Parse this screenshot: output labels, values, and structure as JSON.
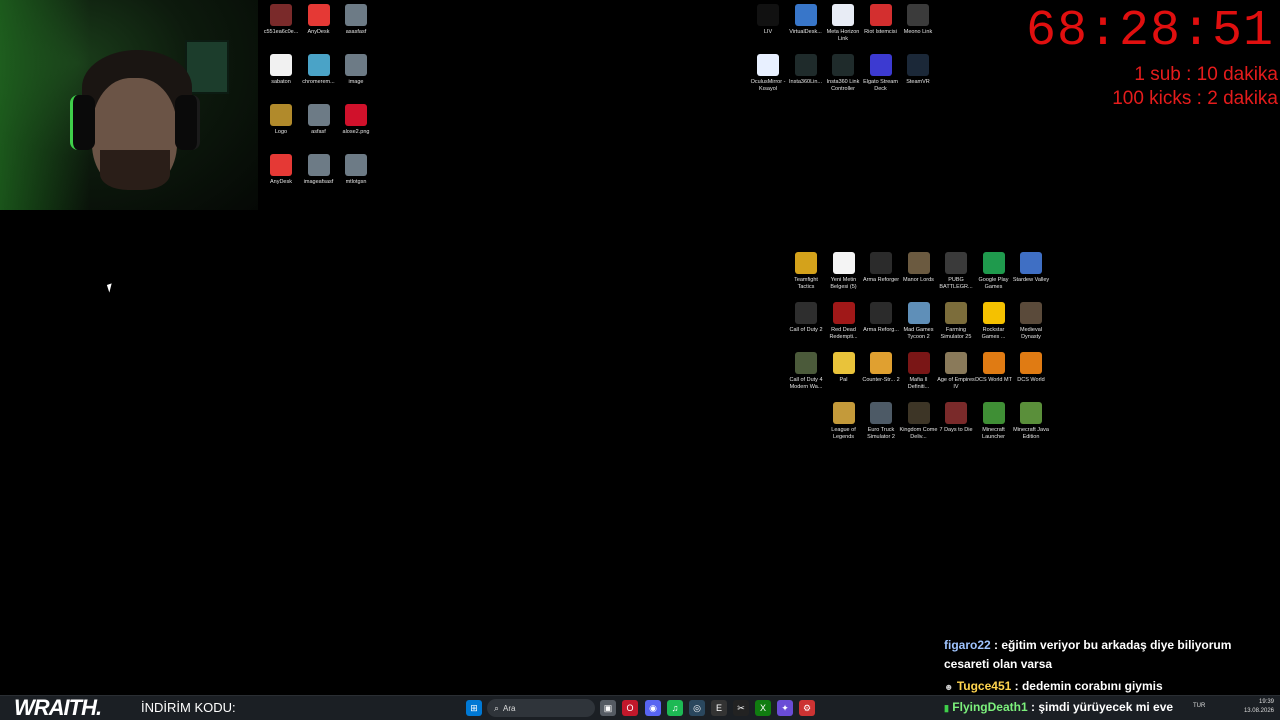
{
  "webcam": {
    "label": "streamer-webcam"
  },
  "timer": {
    "value": "68:28:51",
    "line1": "1 sub : 10 dakika",
    "line2": "100 kicks : 2 dakika"
  },
  "desktop_left": [
    {
      "label": "c551ea6c0e...",
      "color": "#7a2a2a"
    },
    {
      "label": "AnyDesk",
      "color": "#e53935"
    },
    {
      "label": "asasfasf",
      "color": "#6d7b86"
    },
    {
      "label": "sabaton",
      "color": "#f1f1f1"
    },
    {
      "label": "chromerem...",
      "color": "#4aa3c7"
    },
    {
      "label": "image",
      "color": "#6d7b86"
    },
    {
      "label": "Logo",
      "color": "#b18a2b"
    },
    {
      "label": "asfasf",
      "color": "#6d7b86"
    },
    {
      "label": "alose2.png",
      "color": "#d0112b"
    },
    {
      "label": "AnyDesk",
      "color": "#e53935"
    },
    {
      "label": "imageafsasf",
      "color": "#6d7b86"
    },
    {
      "label": "mtlotgsn",
      "color": "#6d7b86"
    }
  ],
  "desktop_top": [
    {
      "label": "LIV",
      "color": "#111111"
    },
    {
      "label": "VirtualDesk...",
      "color": "#3876c9"
    },
    {
      "label": "Meta Horizon Link",
      "color": "#e8ecf5"
    },
    {
      "label": "Riot İstemcisi",
      "color": "#d32f2f"
    },
    {
      "label": "Meono Link",
      "color": "#3b3b3b"
    },
    {
      "label": "OculusMirror - Kısayol",
      "color": "#e8f0ff"
    },
    {
      "label": "Insta360Lin...",
      "color": "#1f2b2b"
    },
    {
      "label": "Insta360 Link Controller",
      "color": "#1f2b2b"
    },
    {
      "label": "Elgato Stream Deck",
      "color": "#3c3ad1"
    },
    {
      "label": "SteamVR",
      "color": "#1b2838"
    }
  ],
  "desktop_games": [
    {
      "label": "Teamfight Tactics",
      "color": "#d4a21b"
    },
    {
      "label": "Yeni Metin Belgesi (5)",
      "color": "#f4f4f4"
    },
    {
      "label": "Arma Reforger",
      "color": "#2b2b2b"
    },
    {
      "label": "Manor Lords",
      "color": "#6b5a40"
    },
    {
      "label": "PUBG BATTLEGR...",
      "color": "#3a3a3a"
    },
    {
      "label": "Google Play Games",
      "color": "#1f9a4d"
    },
    {
      "label": "Stardew Valley",
      "color": "#3f6fc4"
    },
    {
      "label": "Call of Duty 2",
      "color": "#2e2e2e"
    },
    {
      "label": "Red Dead Redempti...",
      "color": "#a01818"
    },
    {
      "label": "Arma Reforg...",
      "color": "#2b2b2b"
    },
    {
      "label": "Mad Games Tycoon 2",
      "color": "#5f8fb8"
    },
    {
      "label": "Farming Simulator 25",
      "color": "#7c6d3b"
    },
    {
      "label": "Rockstar Games ...",
      "color": "#f5c100"
    },
    {
      "label": "Medieval Dynasty",
      "color": "#5a4a3a"
    },
    {
      "label": "Call of Duty 4 Modern Wa...",
      "color": "#4b5a3a"
    },
    {
      "label": "Pal",
      "color": "#e9c33a"
    },
    {
      "label": "Counter-Str... 2",
      "color": "#e0a030"
    },
    {
      "label": "Mafia II Definiti...",
      "color": "#7a1616"
    },
    {
      "label": "Age of Empires IV",
      "color": "#8a7a5a"
    },
    {
      "label": "DCS World MT",
      "color": "#e07b13"
    },
    {
      "label": "DCS World",
      "color": "#e07b13"
    },
    {
      "label": "League of Legends",
      "color": "#c49a3a"
    },
    {
      "label": "Euro Truck Simulator 2",
      "color": "#4d5a66"
    },
    {
      "label": "Kingdom Come Deliv...",
      "color": "#3d3526"
    },
    {
      "label": "7 Days to Die",
      "color": "#7a2a2a"
    },
    {
      "label": "Minecraft Launcher",
      "color": "#3f8f35"
    },
    {
      "label": "Minecraft Java Edition",
      "color": "#5a8f3a"
    }
  ],
  "chat": [
    {
      "user": "figaro22",
      "text": " : eğitim veriyor bu arkadaş diye biliyorum cesareti olan varsa"
    },
    {
      "user": "Tugce451",
      "text": " : dedemin corabını giymis"
    },
    {
      "user": "FlyingDeath1",
      "text": " : şimdi yürüyecek mi eve"
    }
  ],
  "taskbar": {
    "brand": "WRAITH.",
    "promo": "İNDİRİM KODU:",
    "search_placeholder": "Ara",
    "lang": "TUR",
    "time": "19:39",
    "date": "13.08.2026",
    "icons": [
      {
        "name": "windows-start-icon",
        "glyph": "⊞",
        "color": "#0078d4"
      },
      {
        "name": "task-view-icon",
        "glyph": "▣",
        "color": "#555b63"
      },
      {
        "name": "opera-gx-icon",
        "glyph": "O",
        "color": "#c2182b"
      },
      {
        "name": "discord-icon",
        "glyph": "◉",
        "color": "#5865f2"
      },
      {
        "name": "spotify-icon",
        "glyph": "♫",
        "color": "#1db954"
      },
      {
        "name": "steam-icon",
        "glyph": "◎",
        "color": "#2a475e"
      },
      {
        "name": "epic-games-icon",
        "glyph": "E",
        "color": "#333"
      },
      {
        "name": "capcut-icon",
        "glyph": "✂",
        "color": "#222"
      },
      {
        "name": "xbox-icon",
        "glyph": "X",
        "color": "#107c10"
      },
      {
        "name": "copilot-icon",
        "glyph": "✦",
        "color": "#6a4cd6"
      },
      {
        "name": "settings-app-icon",
        "glyph": "⚙",
        "color": "#c33"
      }
    ]
  }
}
